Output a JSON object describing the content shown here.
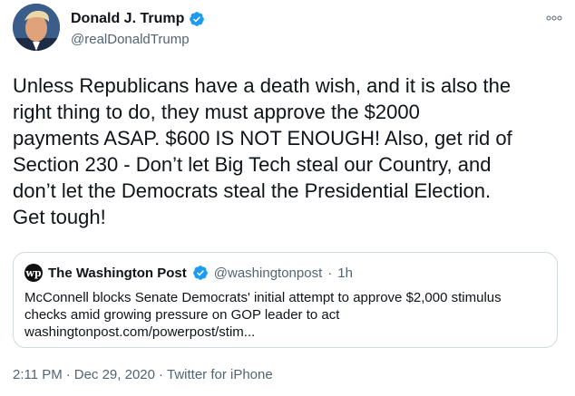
{
  "author": {
    "name": "Donald J. Trump",
    "handle": "@realDonaldTrump"
  },
  "tweet": {
    "text": "Unless Republicans have a death wish, and it is also the\nright thing to do, they must approve the $2000\npayments ASAP. $600 IS NOT ENOUGH! Also, get rid of\nSection 230 - Don’t let Big Tech steal our Country, and\ndon’t let the Democrats steal the Presidential Election.\nGet tough!"
  },
  "quote": {
    "logo_text": "wp",
    "name": "The Washington Post",
    "handle": "@washingtonpost",
    "separator": "·",
    "time": "1h",
    "lines": [
      "McConnell blocks Senate Democrats' initial attempt to approve $2,000 stimulus",
      "checks amid growing pressure on GOP leader to act",
      "washingtonpost.com/powerpost/stim..."
    ]
  },
  "footer": {
    "time": "2:11 PM",
    "date": "Dec 29, 2020",
    "separator": "·",
    "source": "Twitter for iPhone"
  },
  "colors": {
    "verified": "#1d9bf0",
    "secondary_text": "#536471",
    "border": "#cfd9de"
  },
  "icons": {
    "more": "more-icon",
    "verified": "verified-badge-icon"
  }
}
